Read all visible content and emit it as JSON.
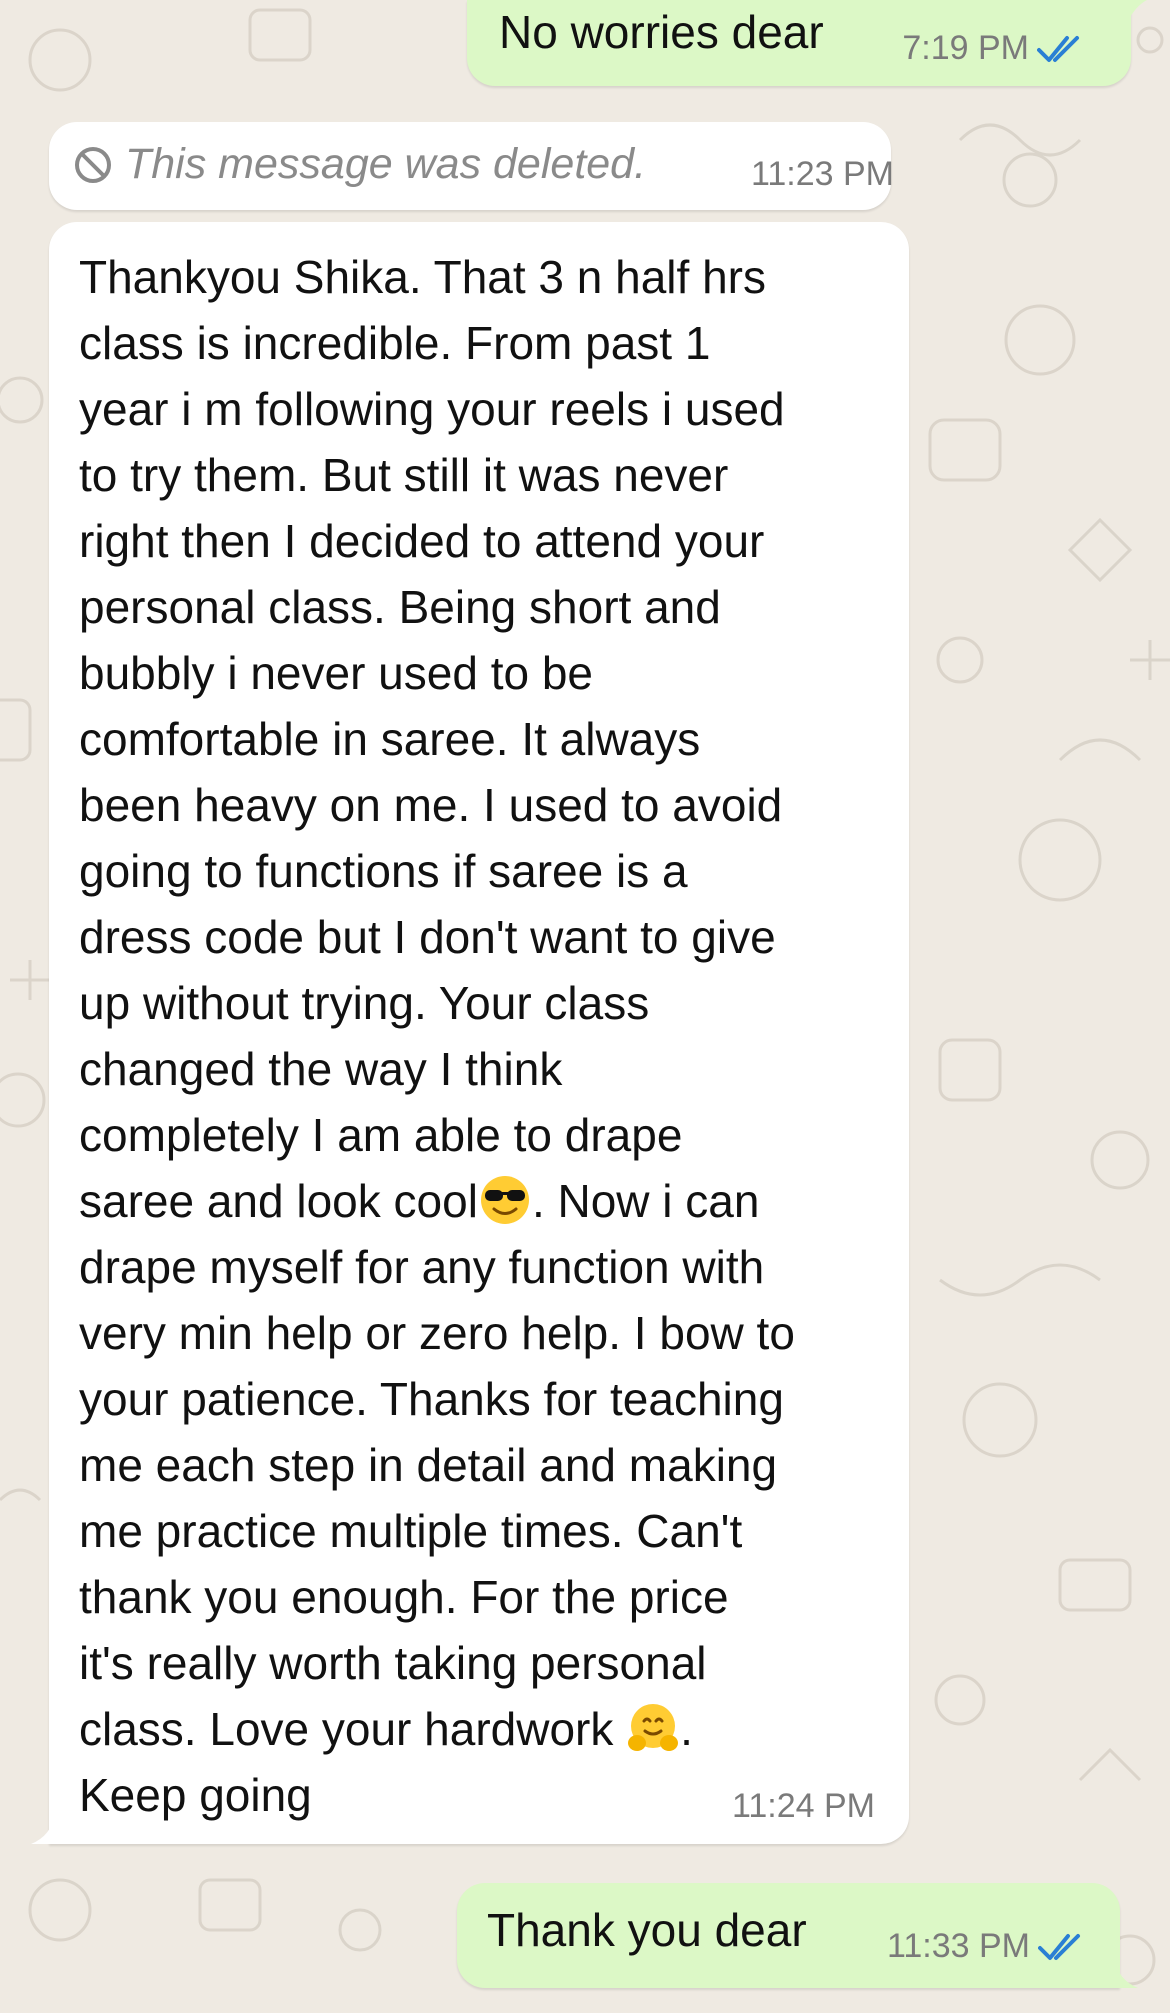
{
  "colors": {
    "chat_background": "#efeae2",
    "outgoing_bubble": "#dcf8c6",
    "incoming_bubble": "#ffffff",
    "read_ticks": "#2a7fd4",
    "timestamp": "#7a7a7a"
  },
  "messages": [
    {
      "direction": "outgoing",
      "text": "No worries dear",
      "time": "7:19 PM",
      "status_icon": "double-check-read-icon"
    },
    {
      "direction": "incoming",
      "deleted": true,
      "text": "This message was deleted.",
      "time": "11:23 PM",
      "icon": "prohibited-icon"
    },
    {
      "direction": "incoming",
      "time": "11:24 PM",
      "lines": [
        "Thankyou Shika. That 3 n half hrs",
        "class is incredible. From past 1",
        "year i m following your reels i used",
        "to try them. But still it was never",
        "right then I decided to attend your",
        "personal class. Being short and",
        "bubbly i never used to be",
        "comfortable in saree. It always",
        "been heavy on me. I used to avoid",
        "going to functions if saree is a",
        "dress code but I don't want to give",
        "up without trying. Your class",
        "changed the way I think",
        "completely I am able to drape",
        "saree and look cool",
        ". Now i can",
        "drape myself for any function with",
        "very min help or zero help. I bow to",
        "your patience. Thanks for teaching",
        "me each step in detail and making",
        "me practice multiple times. Can't",
        "thank you enough. For the price",
        "it's really worth taking personal",
        "class. Love your hardwork ",
        ".",
        "Keep going"
      ],
      "emojis": [
        "smiling-face-with-sunglasses-icon",
        "hugging-face-icon"
      ]
    },
    {
      "direction": "outgoing",
      "text": "Thank you dear",
      "time": "11:33 PM",
      "status_icon": "double-check-read-icon"
    }
  ]
}
